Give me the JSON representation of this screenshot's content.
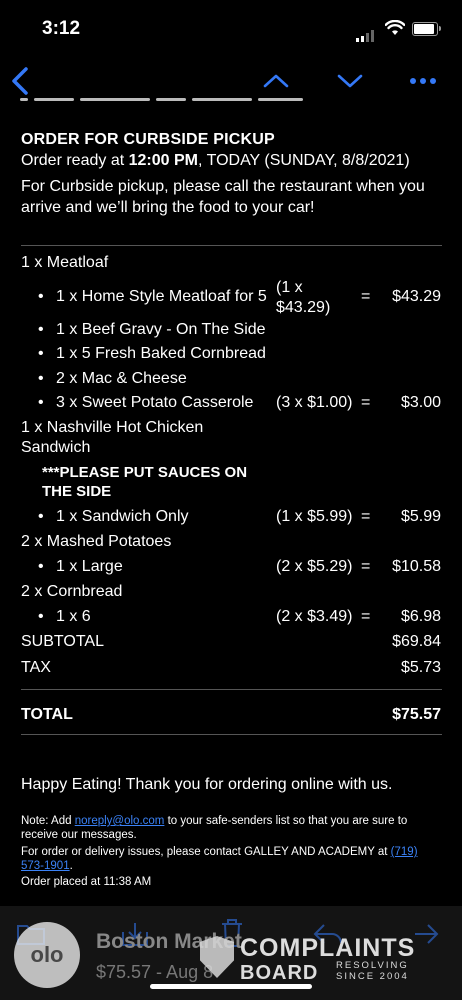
{
  "status": {
    "time": "3:12"
  },
  "nav": {
    "back_icon": "chevron-left-icon",
    "prev_icon": "chevron-up-icon",
    "next_icon": "chevron-down-icon",
    "more_icon": "more-horizontal-icon",
    "accent": "#3478f6"
  },
  "order": {
    "heading": "ORDER FOR CURBSIDE PICKUP",
    "ready_prefix": "Order ready at ",
    "ready_time": "12:00 PM",
    "ready_suffix": ", TODAY (SUNDAY, 8/8/2021)",
    "instructions": "For Curbside pickup, please call the restaurant when you arrive and we’ll bring the food to your car!"
  },
  "items": {
    "meatloaf": {
      "name": "1 x Meatloaf",
      "subs": [
        {
          "name": "1 x Home Style Meatloaf for 5",
          "qty_line1": "(1 x",
          "qty_line2": "$43.29)",
          "eq": "=",
          "amount": "$43.29"
        },
        {
          "name": "1 x Beef Gravy - On The Side"
        },
        {
          "name": "1 x 5 Fresh Baked Cornbread"
        },
        {
          "name": "2 x Mac & Cheese"
        },
        {
          "name": "3 x Sweet Potato Casserole",
          "qty": "(3 x $1.00)",
          "eq": "=",
          "amount": "$3.00"
        }
      ]
    },
    "chicken": {
      "name_line1": "1 x Nashville Hot Chicken",
      "name_line2": "Sandwich",
      "note_line1": "***PLEASE PUT SAUCES ON",
      "note_line2": "THE SIDE",
      "subs": [
        {
          "name": "1 x Sandwich Only",
          "qty": "(1 x $5.99)",
          "eq": "=",
          "amount": "$5.99"
        }
      ]
    },
    "potatoes": {
      "name": "2 x Mashed Potatoes",
      "subs": [
        {
          "name": "1 x Large",
          "qty": "(2 x $5.29)",
          "eq": "=",
          "amount": "$10.58"
        }
      ]
    },
    "cornbread": {
      "name": "2 x Cornbread",
      "subs": [
        {
          "name": "1 x 6",
          "qty": "(2 x $3.49)",
          "eq": "=",
          "amount": "$6.98"
        }
      ]
    }
  },
  "totals": {
    "subtotal_label": "SUBTOTAL",
    "subtotal": "$69.84",
    "tax_label": "TAX",
    "tax": "$5.73",
    "total_label": "TOTAL",
    "total": "$75.57"
  },
  "footer": {
    "thanks": "Happy Eating! Thank you for ordering online with us.",
    "note_prefix": "Note: Add ",
    "note_email": "noreply@olo.com",
    "note_suffix": " to your safe-senders list so that you are sure to receive our messages.",
    "issues_prefix": "For order or delivery issues, please contact GALLEY AND ACADEMY at ",
    "issues_phone": "(719) 573-1901",
    "issues_suffix": ".",
    "placed": "Order placed at 11:38 AM"
  },
  "bottom": {
    "logo_text": "olo",
    "sender": "Boston Market",
    "preview": "$75.57 - Aug 8",
    "icons": [
      "folder-icon",
      "archive-icon",
      "trash-icon",
      "reply-icon",
      "forward-icon"
    ]
  },
  "watermark": {
    "line1": "COMPLAINTS",
    "line2": "BOARD",
    "tagline1": "RESOLVING",
    "tagline2": "SINCE 2004"
  }
}
